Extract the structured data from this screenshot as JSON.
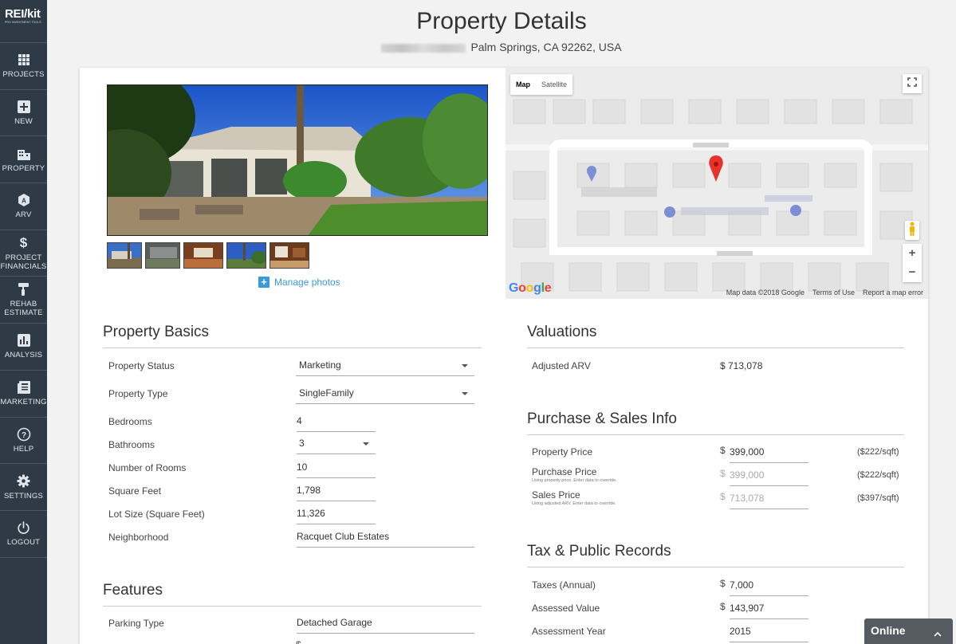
{
  "app": {
    "brand": "REI/kit",
    "tagline": "PRO INVESTMENT TOOLS"
  },
  "sidebar": {
    "items": [
      {
        "label": "PROJECTS",
        "icon": "grid-icon"
      },
      {
        "label": "NEW",
        "icon": "plus-box-icon"
      },
      {
        "label": "PROPERTY",
        "icon": "building-icon"
      },
      {
        "label": "ARV",
        "icon": "arv-icon"
      },
      {
        "label": "PROJECT FINANCIALS",
        "icon": "dollar-icon"
      },
      {
        "label": "REHAB ESTIMATE",
        "icon": "paint-roller-icon"
      },
      {
        "label": "ANALYSIS",
        "icon": "bar-chart-icon"
      },
      {
        "label": "MARKETING",
        "icon": "newspaper-icon"
      },
      {
        "label": "HELP",
        "icon": "help-icon"
      },
      {
        "label": "SETTINGS",
        "icon": "gear-icon"
      },
      {
        "label": "LOGOUT",
        "icon": "power-icon"
      }
    ]
  },
  "header": {
    "title": "Property Details",
    "address": "Palm Springs, CA 92262, USA"
  },
  "photos": {
    "manage_label": "Manage photos",
    "thumb_count": 5
  },
  "map": {
    "tab_map": "Map",
    "tab_satellite": "Satellite",
    "zoom_in": "+",
    "zoom_out": "−",
    "logo": "Google",
    "data_credit": "Map data ©2018 Google",
    "terms": "Terms of Use",
    "report": "Report a map error"
  },
  "basics": {
    "title": "Property Basics",
    "status_label": "Property Status",
    "status_value": "Marketing",
    "type_label": "Property Type",
    "type_value": "SingleFamily",
    "bedrooms_label": "Bedrooms",
    "bedrooms_value": "4",
    "bathrooms_label": "Bathrooms",
    "bathrooms_value": "3",
    "rooms_label": "Number of Rooms",
    "rooms_value": "10",
    "sqft_label": "Square Feet",
    "sqft_value": "1,798",
    "lot_label": "Lot Size (Square Feet)",
    "lot_value": "11,326",
    "neigh_label": "Neighborhood",
    "neigh_value": "Racquet Club Estates"
  },
  "features": {
    "title": "Features",
    "parking_label": "Parking Type",
    "parking_value": "Detached Garage",
    "next_dollar": "$"
  },
  "valuations": {
    "title": "Valuations",
    "arv_label": "Adjusted ARV",
    "arv_value": "$ 713,078"
  },
  "purchase": {
    "title": "Purchase & Sales Info",
    "currency": "$",
    "property_price_label": "Property Price",
    "property_price_value": "399,000",
    "property_price_sqft": "($222/sqft)",
    "purchase_price_label": "Purchase Price",
    "purchase_price_hint": "Using property price. Enter data to override.",
    "purchase_price_value": "399,000",
    "purchase_price_sqft": "($222/sqft)",
    "sales_price_label": "Sales Price",
    "sales_price_hint": "Using adjusted ARV. Enter data to override.",
    "sales_price_value": "713,078",
    "sales_price_sqft": "($397/sqft)"
  },
  "tax": {
    "title": "Tax & Public Records",
    "currency": "$",
    "taxes_label": "Taxes (Annual)",
    "taxes_value": "7,000",
    "assessed_label": "Assessed Value",
    "assessed_value": "143,907",
    "year_label": "Assessment Year",
    "year_value": "2015"
  },
  "chat": {
    "label": "Online"
  }
}
